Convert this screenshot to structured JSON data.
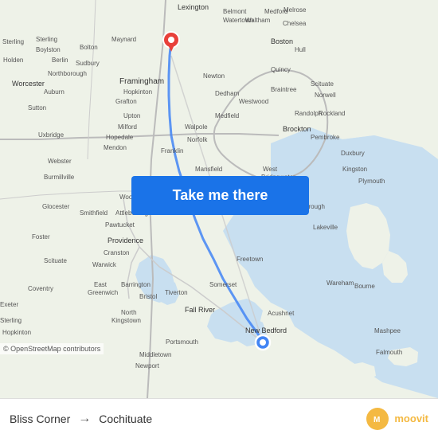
{
  "map": {
    "attribution": "© OpenStreetMap contributors",
    "destination_pin_color": "#e8403a",
    "origin_pin_color": "#4285f4",
    "destination_label": "Lexington"
  },
  "button": {
    "label": "Take me there"
  },
  "bottom_bar": {
    "origin": "Bliss Corner",
    "arrow": "→",
    "destination": "Cochituate",
    "moovit_text": "moovit"
  }
}
